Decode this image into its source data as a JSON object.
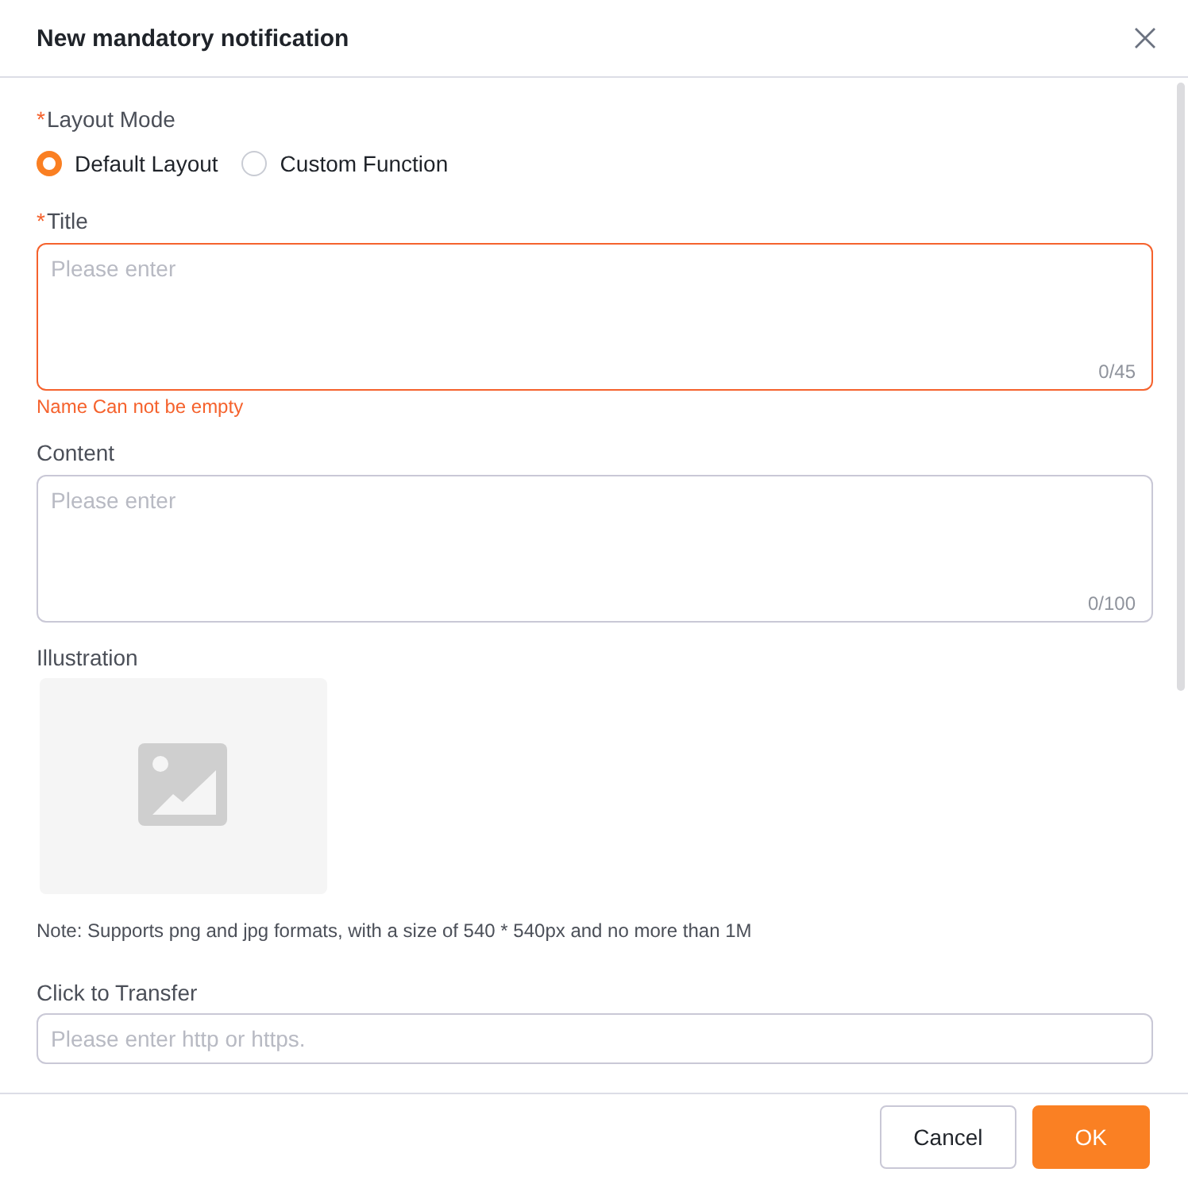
{
  "dialog": {
    "title": "New mandatory notification"
  },
  "layout_mode": {
    "label": "Layout Mode",
    "required_mark": "*",
    "options": [
      {
        "label": "Default Layout",
        "selected": true
      },
      {
        "label": "Custom Function",
        "selected": false
      }
    ]
  },
  "title_field": {
    "label": "Title",
    "required_mark": "*",
    "placeholder": "Please enter",
    "counter": "0/45",
    "error": "Name Can not be empty"
  },
  "content_field": {
    "label": "Content",
    "placeholder": "Please enter",
    "counter": "0/100"
  },
  "illustration": {
    "label": "Illustration",
    "note": "Note: Supports png and jpg formats, with a size of 540 * 540px and no more than 1M"
  },
  "transfer_field": {
    "label": "Click to Transfer",
    "placeholder": "Please enter http or https."
  },
  "buttons": [
    {
      "label": "Cancel",
      "kind": "secondary"
    },
    {
      "label": "OK",
      "kind": "primary"
    }
  ]
}
